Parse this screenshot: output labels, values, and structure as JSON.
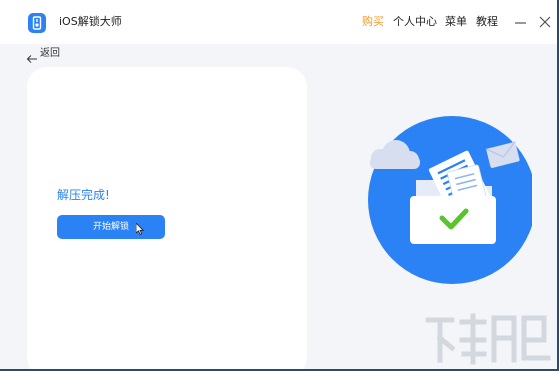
{
  "app": {
    "title": "iOS解锁大师",
    "logo_icon": "lock-phone-icon"
  },
  "menu": {
    "buy": "购买",
    "account": "个人中心",
    "menu": "菜单",
    "tutorial": "教程"
  },
  "window_controls": {
    "minimize_icon": "minimize-icon",
    "close_icon": "close-icon"
  },
  "back": {
    "label": "返回",
    "icon": "arrow-left-icon"
  },
  "main": {
    "status": "解压完成!",
    "start_button": "开始解锁"
  },
  "illustration": {
    "icon": "folder-with-check-icon"
  },
  "watermark": {
    "icon": "watermark-logo"
  },
  "colors": {
    "accent": "#2a82f5",
    "buy": "#f39a2b",
    "check": "#5ac52a",
    "background": "#f3f5f9"
  }
}
